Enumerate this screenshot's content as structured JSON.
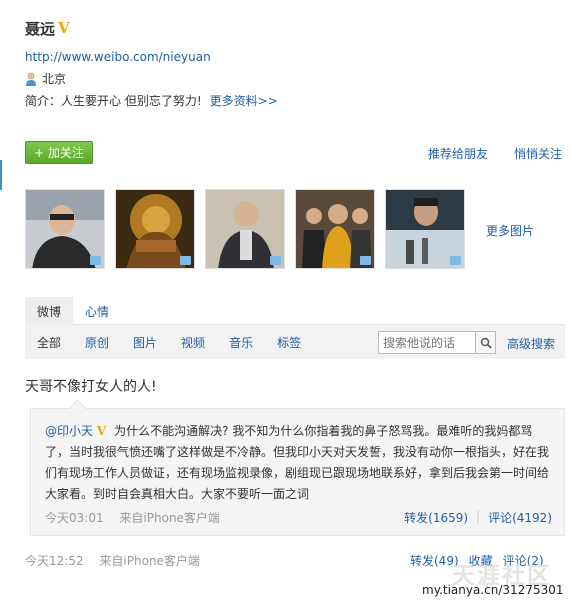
{
  "profile": {
    "name": "聂远",
    "verified_badge": "V",
    "url": "http://www.weibo.com/nieyuan",
    "location": "北京",
    "intro_label": "简介：",
    "intro_text": "人生要开心 但别忘了努力!",
    "more_info": "更多资料>>"
  },
  "actions": {
    "follow": "+ 加关注",
    "recommend": "推荐给朋友",
    "quiet_follow": "悄悄关注"
  },
  "photos": {
    "count": 5,
    "more_label": "更多图片"
  },
  "tabs": [
    "微博",
    "心情"
  ],
  "filters": [
    "全部",
    "原创",
    "图片",
    "视频",
    "音乐",
    "标签"
  ],
  "search": {
    "placeholder": "搜索他说的话",
    "advanced": "高级搜索"
  },
  "post": {
    "text": "天哥不像打女人的人!",
    "time": "今天12:52",
    "source": "来自iPhone客户端",
    "repost_label": "转发(49)",
    "fav_label": "收藏",
    "comment_label": "评论(2)"
  },
  "repost": {
    "author": "@印小天",
    "badge": "V",
    "text": "为什么不能沟通解决? 我不知为什么你指着我的鼻子怒骂我。最难听的我妈都骂了，当时我很气愤还嘴了这样做是不冷静。但我印小天对天发誓，我没有动你一根指头，好在我们有现场工作人员做证，还有现场监视录像，剧组现已跟现场地联系好，拿到后我会第一时间给大家看。到时自会真相大白。大家不要听一面之词",
    "time": "今天03:01",
    "source": "来自iPhone客户端",
    "repost_label": "转发(1659)",
    "comment_label": "评论(4192)"
  },
  "watermark": {
    "text": "天涯社区",
    "url": "my.tianya.cn/31275301"
  },
  "colors": {
    "link": "#1f5fa8",
    "verified": "#f5a10e",
    "follow_green": "#5aa92a"
  }
}
